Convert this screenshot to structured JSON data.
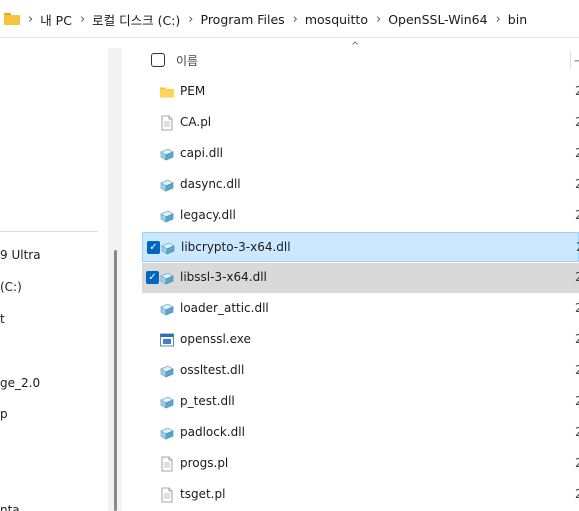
{
  "breadcrumb": {
    "items": [
      "내 PC",
      "로컬 디스크 (C:)",
      "Program Files",
      "mosquitto",
      "OpenSSL-Win64",
      "bin"
    ],
    "separator": "›"
  },
  "nav": {
    "items": [
      "9 Ultra",
      "(C:)",
      "t",
      "ge_2.0",
      "p",
      "nta"
    ]
  },
  "list": {
    "header": {
      "name": "이름",
      "next_col_fragment": "ᅩ"
    },
    "files": [
      {
        "name": "PEM",
        "icon": "folder-icon",
        "selected": false,
        "date_fragment": "2"
      },
      {
        "name": "CA.pl",
        "icon": "text-file-icon",
        "selected": false,
        "date_fragment": "2"
      },
      {
        "name": "capi.dll",
        "icon": "dll-file-icon",
        "selected": false,
        "date_fragment": "2"
      },
      {
        "name": "dasync.dll",
        "icon": "dll-file-icon",
        "selected": false,
        "date_fragment": "2"
      },
      {
        "name": "legacy.dll",
        "icon": "dll-file-icon",
        "selected": false,
        "date_fragment": "2"
      },
      {
        "name": "libcrypto-3-x64.dll",
        "icon": "dll-file-icon",
        "selected": true,
        "date_fragment": "2"
      },
      {
        "name": "libssl-3-x64.dll",
        "icon": "dll-file-icon",
        "selected": true,
        "date_fragment": "2"
      },
      {
        "name": "loader_attic.dll",
        "icon": "dll-file-icon",
        "selected": false,
        "date_fragment": "2"
      },
      {
        "name": "openssl.exe",
        "icon": "exe-file-icon",
        "selected": false,
        "date_fragment": "2"
      },
      {
        "name": "ossltest.dll",
        "icon": "dll-file-icon",
        "selected": false,
        "date_fragment": "2"
      },
      {
        "name": "p_test.dll",
        "icon": "dll-file-icon",
        "selected": false,
        "date_fragment": "2"
      },
      {
        "name": "padlock.dll",
        "icon": "dll-file-icon",
        "selected": false,
        "date_fragment": "2"
      },
      {
        "name": "progs.pl",
        "icon": "text-file-icon",
        "selected": false,
        "date_fragment": "2"
      },
      {
        "name": "tsget.pl",
        "icon": "text-file-icon",
        "selected": false,
        "date_fragment": "2"
      }
    ]
  },
  "colors": {
    "selection_bg": "#cce8ff",
    "selection_border": "#99d1ff",
    "selection_inactive_bg": "#d9d9d9",
    "checkbox_accent": "#0067c0",
    "folder": "#f8c33c"
  }
}
